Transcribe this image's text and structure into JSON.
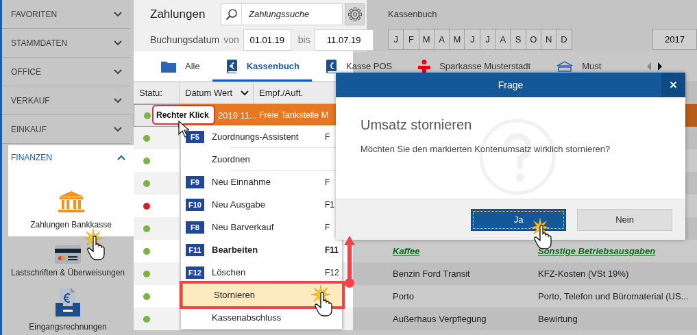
{
  "sidebar": {
    "sections": [
      {
        "label": "FAVORITEN",
        "expanded": false
      },
      {
        "label": "STAMMDATEN",
        "expanded": false
      },
      {
        "label": "OFFICE",
        "expanded": false
      },
      {
        "label": "VERKAUF",
        "expanded": false
      },
      {
        "label": "EINKAUF",
        "expanded": false
      },
      {
        "label": "FINANZEN",
        "expanded": true,
        "items": [
          {
            "label": "Zahlungen Bankkasse",
            "selected": true
          },
          {
            "label": "Lastschriften & Überweisungen",
            "selected": false
          },
          {
            "label": "Eingangsrechnungen",
            "selected": false
          }
        ]
      }
    ]
  },
  "toolbar": {
    "title": "Zahlungen",
    "search": {
      "placeholder": "Zahlungssuche"
    },
    "date_label": "Buchungsdatum",
    "from_label": "von",
    "from": "01.01.19",
    "to_label": "bis",
    "to": "11.07.19"
  },
  "period": {
    "label": "Kassenbuch",
    "months": [
      "J",
      "F",
      "M",
      "A",
      "M",
      "J",
      "J",
      "A",
      "S",
      "O",
      "N",
      "D"
    ],
    "year": "2017"
  },
  "tabs": [
    {
      "label": "Alle",
      "selected": false
    },
    {
      "label": "Kassenbuch",
      "selected": true
    },
    {
      "label": "Kasse POS",
      "selected": false
    },
    {
      "label": "Sparkasse Musterstadt",
      "selected": false
    },
    {
      "label": "Must",
      "selected": false
    }
  ],
  "table": {
    "columns": [
      "Statu:",
      "Datum Wert",
      "Empf./Auft."
    ],
    "rows": [
      {
        "color": "#7cb342",
        "selected": true,
        "date": "2019 11...",
        "payee": "Freie Tankstelle M"
      },
      {
        "color": "#7cb342",
        "selected": false
      },
      {
        "color": "#7cb342",
        "selected": false
      },
      {
        "color": "#7cb342",
        "selected": false
      },
      {
        "color": "#c62828",
        "selected": false
      },
      {
        "color": "#7cb342",
        "selected": false
      },
      {
        "color": "#7cb342",
        "selected": false,
        "emphasized": true,
        "purpose": "Kaffee",
        "category": "Sonstige Betriebsausgaben"
      },
      {
        "color": "#7cb342",
        "selected": false,
        "emphasized": false,
        "purpose": "Benzin Ford Transit",
        "category": "KFZ-Kosten (VSt 19%)"
      },
      {
        "color": "#7cb342",
        "selected": false,
        "emphasized": false,
        "purpose": "Porto",
        "category": "Porto, Telefon und Büromaterial (US..."
      },
      {
        "color": "#7cb342",
        "selected": false,
        "emphasized": false,
        "purpose": "Außerhaus Verpflegung",
        "category": "Bewirtung"
      }
    ]
  },
  "callout": {
    "text": "Rechter Klick"
  },
  "context_menu": {
    "items": [
      {
        "key": "F5",
        "label": "Zuordnungs-Assistent",
        "shortcut": "F",
        "bold": false,
        "selected": false,
        "separator_below": true
      },
      {
        "label": "Zuordnen",
        "bold": false,
        "selected": false,
        "separator_below": true
      },
      {
        "key": "F9",
        "label": "Neu Einnahme",
        "shortcut": "F",
        "bold": false,
        "selected": false,
        "separator_below": false
      },
      {
        "key": "F10",
        "label": "Neu Ausgabe",
        "shortcut": "F1",
        "bold": false,
        "selected": false,
        "separator_below": false
      },
      {
        "key": "F8",
        "label": "Neu Barverkauf",
        "shortcut": "F",
        "bold": false,
        "selected": false,
        "separator_below": false
      },
      {
        "key": "F11",
        "label": "Bearbeiten",
        "shortcut": "F11",
        "bold": true,
        "selected": false,
        "separator_below": false
      },
      {
        "key": "F12",
        "label": "Löschen",
        "shortcut": "F12",
        "bold": false,
        "selected": false
      },
      {
        "label": "Stornieren",
        "bold": false,
        "selected": true,
        "separator_below": false
      },
      {
        "label": "Kassenabschluss",
        "bold": false,
        "selected": false,
        "separator_below": false
      }
    ]
  },
  "dialog": {
    "title": "Frage",
    "close": "×",
    "heading": "Umsatz stornieren",
    "message": "Möchten Sie den markierten Kontenumsatz wirklich stornieren?",
    "buttons": [
      {
        "label": "Ja",
        "selected": true
      },
      {
        "label": "Nein",
        "selected": false
      }
    ]
  }
}
